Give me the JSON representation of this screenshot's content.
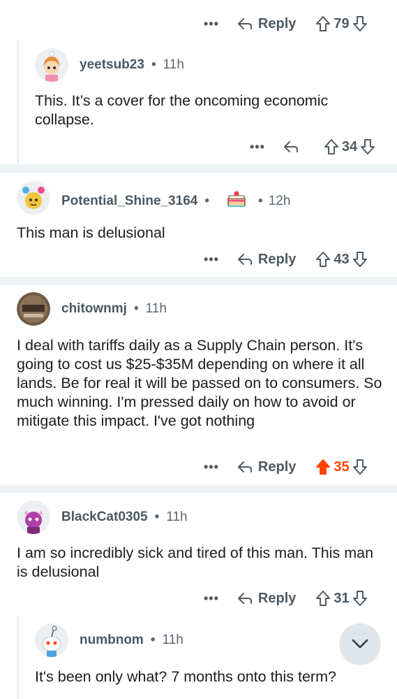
{
  "comments": [
    {
      "id": "top-comment-actions",
      "score": "79",
      "reply_label": "Reply"
    },
    {
      "id": "yeetsub23",
      "username": "yeetsub23",
      "age": "11h",
      "body": "This. It’s a cover for the oncoming economic collapse.",
      "score": "34"
    },
    {
      "id": "potential",
      "username": "Potential_Shine_3164",
      "age": "12h",
      "body": "This man is delusional",
      "score": "43",
      "reply_label": "Reply"
    },
    {
      "id": "chitownmj",
      "username": "chitownmj",
      "age": "11h",
      "body": "I deal with tariffs daily as a Supply Chain person. It's going to cost us $25-$35M depending on where it all lands. Be for real it will be passed on to consumers. So much winning. I'm pressed daily on how to avoid or mitigate this impact.  I've got nothing",
      "score": "35",
      "reply_label": "Reply",
      "upvoted": true
    },
    {
      "id": "blackcat",
      "username": "BlackCat0305",
      "age": "11h",
      "body": "I am so incredibly sick and tired of this man. This man is delusional",
      "score": "31",
      "reply_label": "Reply"
    },
    {
      "id": "numbnom",
      "username": "numbnom",
      "age": "11h",
      "body": "It's been only what? 7 months onto this term?"
    }
  ],
  "colors": {
    "upvote_active": "#ff4500",
    "separator": "#eef2f5",
    "meta": "#5b6770"
  },
  "icons": [
    "more-icon",
    "reply-icon",
    "upvote-icon",
    "downvote-icon",
    "chevron-down-icon"
  ]
}
